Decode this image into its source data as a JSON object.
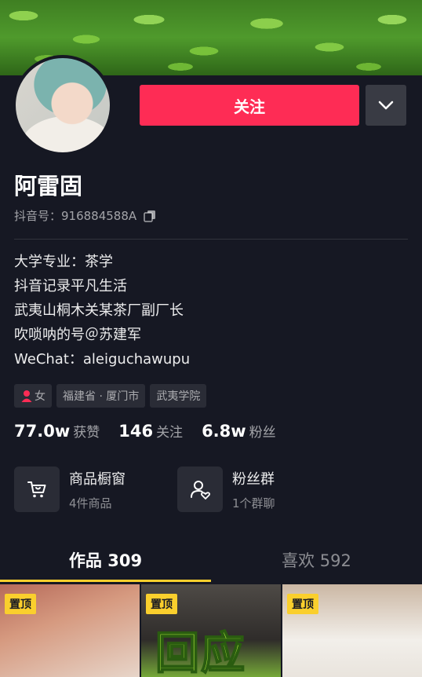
{
  "profile": {
    "follow_label": "关注",
    "name": "阿雷固",
    "douyin_id": "抖音号：916884588A"
  },
  "bio": {
    "lines": [
      "大学专业：茶学",
      "抖音记录平凡生活",
      "武夷山桐木关某茶厂副厂长",
      "吹唢呐的号＠苏建军",
      "WeChat：aleiguchawupu"
    ]
  },
  "tags": {
    "gender": "女",
    "location": "福建省 · 厦门市",
    "school": "武夷学院"
  },
  "stats": [
    {
      "value": "77.0w",
      "label": "获赞"
    },
    {
      "value": "146",
      "label": "关注"
    },
    {
      "value": "6.8w",
      "label": "粉丝"
    }
  ],
  "cards": {
    "shop": {
      "title": "商品橱窗",
      "sub": "4件商品"
    },
    "fans": {
      "title": "粉丝群",
      "sub": "1个群聊"
    }
  },
  "tabs": {
    "works": "作品 309",
    "likes": "喜欢 592"
  },
  "grid": {
    "pin_label": "置顶",
    "overlay_text": "回应"
  },
  "colors": {
    "accent": "#fe2c55",
    "tab_indicator": "#facf2d",
    "background": "#161823"
  }
}
